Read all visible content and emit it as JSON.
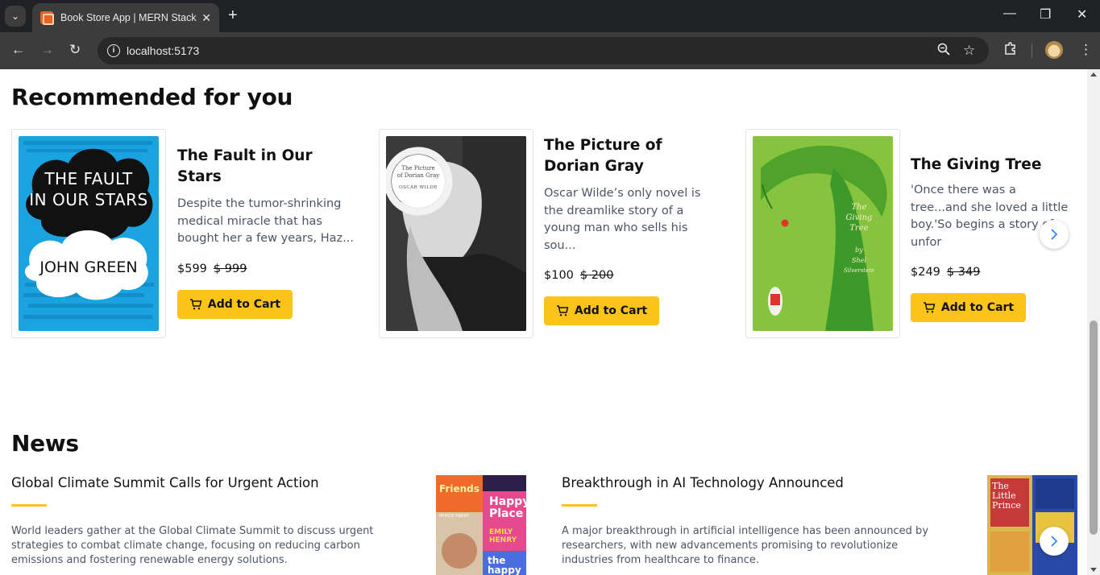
{
  "browser": {
    "tab_title": "Book Store App | MERN Stack P",
    "url": "localhost:5173"
  },
  "recommended": {
    "heading": "Recommended for you",
    "add_to_cart_label": "Add to Cart",
    "books": [
      {
        "title": "The Fault in Our Stars",
        "description": "Despite the tumor-shrinking medical miracle that has bought her a few years, Haz...",
        "price": "$599",
        "old_price": "$ 999",
        "cover_text": [
          "THE FAULT",
          "IN OUR STARS",
          "JOHN GREEN"
        ]
      },
      {
        "title": "The Picture of Dorian Gray",
        "description": "Oscar Wilde’s only novel is the dreamlike story of a young man who sells his sou...",
        "price": "$100",
        "old_price": "$ 200",
        "cover_text": [
          "The Picture",
          "of Dorian Gray",
          "OSCAR WILDE"
        ]
      },
      {
        "title": "The Giving Tree",
        "description": "'Once there was a tree...and she loved a little boy.'So begins a story of unfor",
        "price": "$249",
        "old_price": "$ 349",
        "cover_text": [
          "The",
          "Giving",
          "Tree",
          "by",
          "Shel",
          "Silverstein"
        ]
      }
    ]
  },
  "news": {
    "heading": "News",
    "items": [
      {
        "title": "Global Climate Summit Calls for Urgent Action",
        "description": "World leaders gather at the Global Climate Summit to discuss urgent strategies to combat climate change, focusing on reducing carbon emissions and fostering renewable energy solutions."
      },
      {
        "title": "Breakthrough in AI Technology Announced",
        "description": "A major breakthrough in artificial intelligence has been announced by researchers, with new advancements promising to revolutionize industries from healthcare to finance."
      }
    ],
    "image_text": {
      "friends": "Friends",
      "happy_place": "Happy Place",
      "emily_henry": "EMILY HENRY",
      "prince_harry": "PRINCE HARRY",
      "the_happy": "the happy",
      "little_prince": "The Little Prince"
    }
  },
  "colors": {
    "accent": "#fcc419",
    "chevron": "#3b82f6"
  }
}
